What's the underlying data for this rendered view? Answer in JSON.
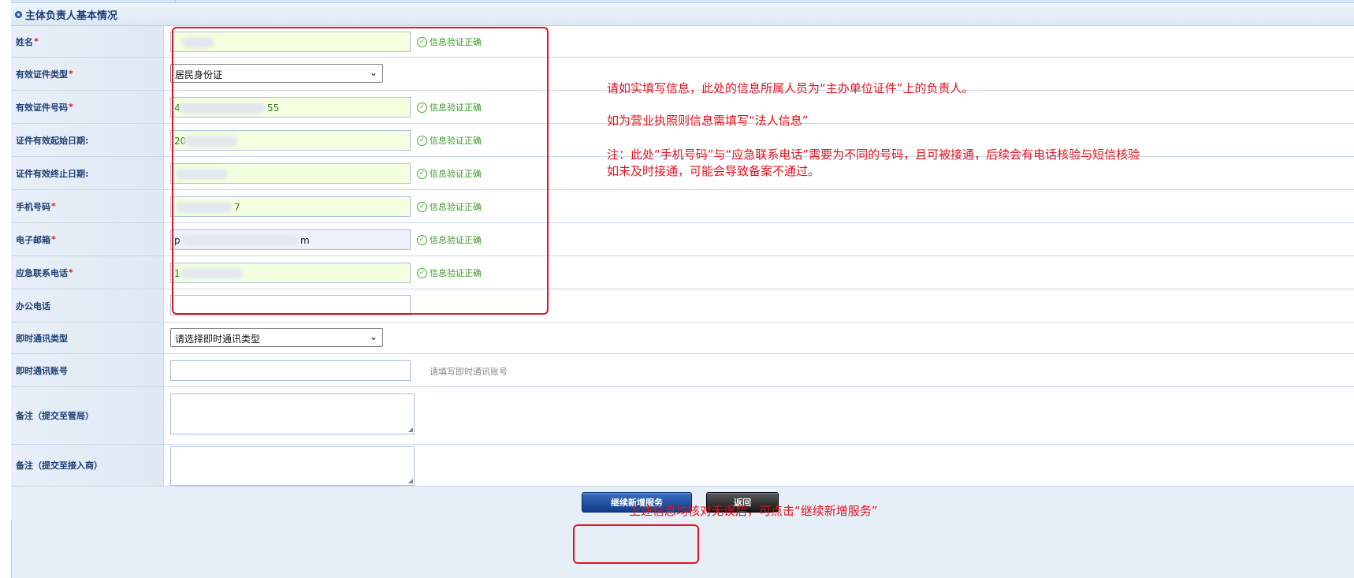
{
  "section": {
    "title": "主体负责人基本情况"
  },
  "fields": [
    {
      "label": "姓名",
      "required": "*",
      "value": "",
      "status": "信息验证正确"
    },
    {
      "label": "有效证件类型",
      "required": "*",
      "select_value": "居民身份证"
    },
    {
      "label": "有效证件号码",
      "required": "*",
      "value": "4",
      "value_tail": "55",
      "status": "信息验证正确"
    },
    {
      "label": "证件有效起始日期:",
      "required": "",
      "value": "20",
      "status": "信息验证正确"
    },
    {
      "label": "证件有效终止日期:",
      "required": "",
      "value": "",
      "status": "信息验证正确"
    },
    {
      "label": "手机号码",
      "required": "*",
      "value": "",
      "value_tail": "7",
      "status": "信息验证正确"
    },
    {
      "label": "电子邮箱",
      "required": "*",
      "value": "p",
      "value_tail": "m",
      "status": "信息验证正确"
    },
    {
      "label": "应急联系电话",
      "required": "*",
      "value": "1",
      "status": "信息验证正确"
    },
    {
      "label": "办公电话",
      "required": "",
      "value": ""
    },
    {
      "label": "即时通讯类型",
      "required": "",
      "select_value": "请选择即时通讯类型"
    },
    {
      "label": "即时通讯账号",
      "required": "",
      "value": "",
      "hint": "请填写即时通讯账号"
    },
    {
      "label": "备注（提交至管局）",
      "required": ""
    },
    {
      "label": "备注（提交至接入商）",
      "required": ""
    }
  ],
  "notes": {
    "line1": "请如实填写信息，此处的信息所属人员为“主办单位证件”上的负责人。",
    "line2": "如为营业执照则信息需填写“法人信息”",
    "line3": "注：此处“手机号码”与“应急联系电话”需要为不同的号码，且可被接通，后续会有电话核验与短信核验",
    "line4": "如未及时接通，可能会导致备案不通过。",
    "line5": "上述信息均核对无误后，可点击“继续新增服务”"
  },
  "buttons": {
    "continue": "继续新增服务",
    "back": "返回"
  },
  "colors": {
    "annotation": "#e0141e",
    "valid": "#3f9a2b",
    "primary": "#1a4a96"
  }
}
